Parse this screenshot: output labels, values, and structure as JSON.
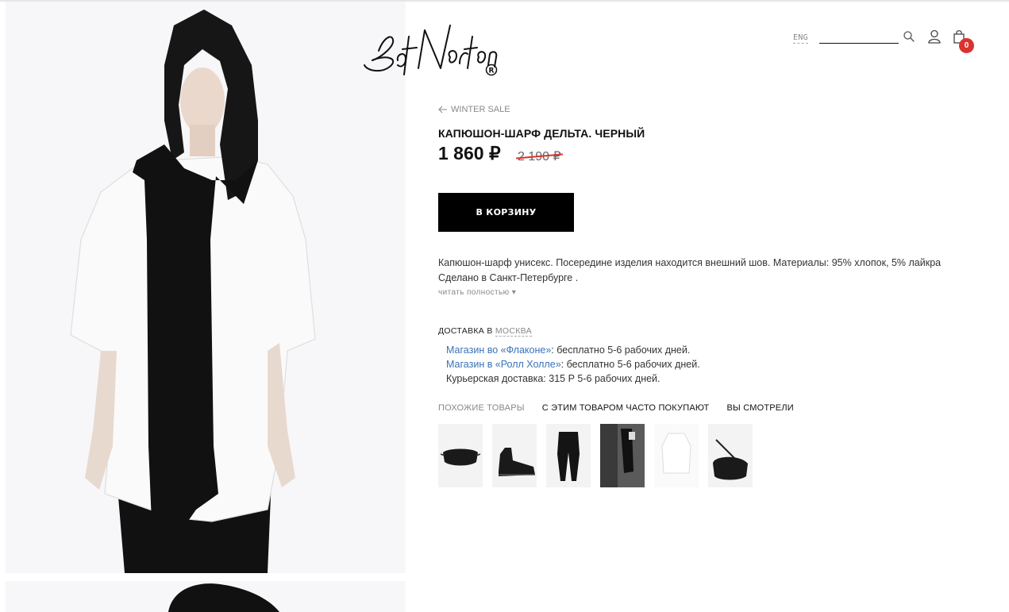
{
  "header": {
    "logo_text": "BatNorton",
    "lang": "ENG",
    "cart_count": "0"
  },
  "product": {
    "back_link": "WINTER SALE",
    "title": "КАПЮШОН-ШАРФ ДЕЛЬТА. ЧЕРНЫЙ",
    "price": "1 860 ₽",
    "old_price": "2 190 ₽",
    "add_to_cart": "В КОРЗИНУ",
    "description_line1": "Капюшон-шарф унисекс. Посередине изделия находится внешний шов. Материалы: 95% хлопок, 5% лайкра",
    "description_line2": "Сделано в Санкт-Петербурге .",
    "read_more": "читать полностью ▾"
  },
  "delivery": {
    "label": "ДОСТАВКА В",
    "city": "МОСКВА",
    "items": [
      {
        "link": "Магазин во «Флаконе»",
        "text": ": бесплатно 5-6 рабочих дней."
      },
      {
        "link": "Магазин в «Ролл Холле»",
        "text": ": бесплатно 5-6 рабочих дней."
      },
      {
        "link": "",
        "text": "Курьерская доставка: 315 Р 5-6 рабочих дней."
      }
    ]
  },
  "tabs": [
    {
      "label": "ПОХОЖИЕ ТОВАРЫ",
      "active": false
    },
    {
      "label": "С ЭТИМ ТОВАРОМ ЧАСТО ПОКУПАЮТ",
      "active": true
    },
    {
      "label": "ВЫ СМОТРЕЛИ",
      "active": true
    }
  ],
  "thumbnails": [
    {
      "name": "face-mask"
    },
    {
      "name": "black-sneakers"
    },
    {
      "name": "black-pants"
    },
    {
      "name": "arm-warmer"
    },
    {
      "name": "white-shirt"
    },
    {
      "name": "black-bag"
    }
  ],
  "colors": {
    "badge": "#d9322f",
    "link": "#3a73b7",
    "button": "#000000"
  }
}
